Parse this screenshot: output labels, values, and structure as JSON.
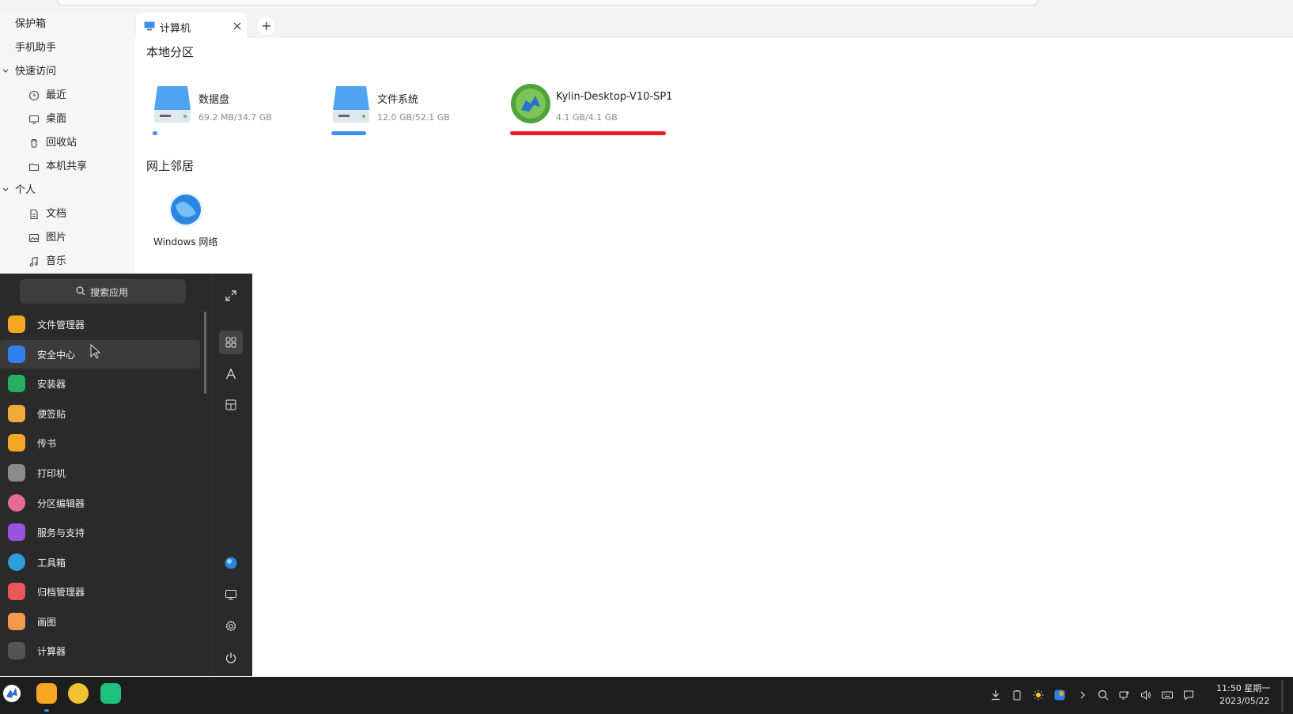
{
  "sidebar": {
    "items": [
      {
        "label": "保护箱"
      },
      {
        "label": "手机助手"
      },
      {
        "label": "快速访问"
      },
      {
        "label": "最近"
      },
      {
        "label": "桌面"
      },
      {
        "label": "回收站"
      },
      {
        "label": "本机共享"
      },
      {
        "label": "个人"
      },
      {
        "label": "文档"
      },
      {
        "label": "图片"
      },
      {
        "label": "音乐"
      }
    ]
  },
  "tabs": {
    "active_label": "计算机",
    "add_label": "+"
  },
  "main": {
    "local_title": "本地分区",
    "drives": [
      {
        "name": "数据盘",
        "size": "69.2 MB/34.7 GB",
        "usage": 0.02
      },
      {
        "name": "文件系统",
        "size": "12.0 GB/52.1 GB",
        "usage": 0.23
      },
      {
        "name": "Kylin-Desktop-V10-SP1",
        "size": "4.1 GB/4.1 GB",
        "usage": 1.0
      }
    ],
    "network_title": "网上邻居",
    "network_item": "Windows 网络"
  },
  "start_menu": {
    "search_placeholder": "搜索应用",
    "apps": [
      {
        "label": "文件管理器",
        "color": "#f5a623"
      },
      {
        "label": "安全中心",
        "color": "#2f80ed"
      },
      {
        "label": "安装器",
        "color": "#27ae60"
      },
      {
        "label": "便签贴",
        "color": "#f2a93b"
      },
      {
        "label": "传书",
        "color": "#f5a623"
      },
      {
        "label": "打印机",
        "color": "#8a8a8a"
      },
      {
        "label": "分区编辑器",
        "color": "#e86a92"
      },
      {
        "label": "服务与支持",
        "color": "#9b51e0"
      },
      {
        "label": "工具箱",
        "color": "#2d9cdb"
      },
      {
        "label": "归档管理器",
        "color": "#eb5757"
      },
      {
        "label": "画图",
        "color": "#f2994a"
      },
      {
        "label": "计算器",
        "color": "#555555"
      }
    ]
  },
  "clock": {
    "time": "11:50 星期一",
    "date": "2023/05/22"
  },
  "colors": {
    "accent": "#3d8ff0",
    "highlight_red": "#e8201c"
  }
}
